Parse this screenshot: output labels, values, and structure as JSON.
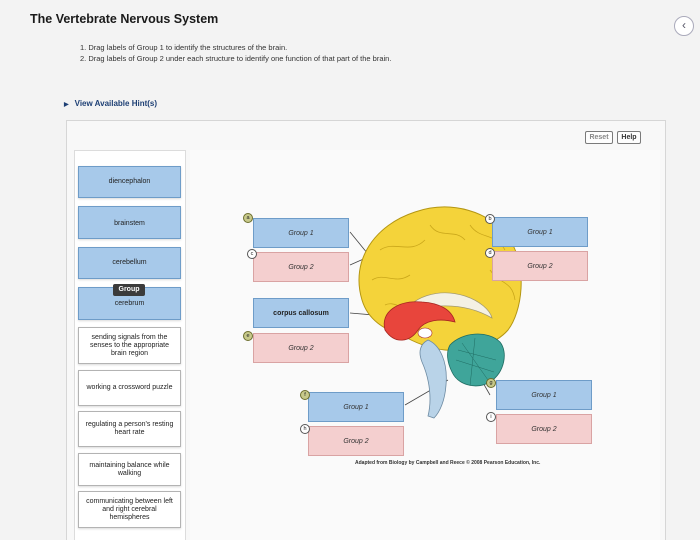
{
  "page": {
    "title": "The Vertebrate Nervous System",
    "instructions": [
      "1.  Drag labels of Group 1 to identify the structures of the brain.",
      "2.  Drag labels of Group 2 under each structure to identify one function of that part of the brain."
    ],
    "hints_link": "View Available Hint(s)"
  },
  "toolbar": {
    "reset_label": "Reset",
    "help_label": "Help"
  },
  "labels": {
    "diencephalon": "diencephalon",
    "brainstem": "brainstem",
    "cerebellum": "cerebellum",
    "cerebrum": "cerebrum",
    "drag_tag": "Group",
    "sensory": "sending signals from the senses to the appropriate brain region",
    "crossword": "working a crossword puzzle",
    "heart": "regulating a person's resting heart rate",
    "balance": "maintaining balance while walking",
    "hemispheres": "communicating between left and right cerebral hemispheres"
  },
  "targets": {
    "a_group1": "Group 1",
    "c_group2": "Group 2",
    "corpus": "corpus callosum",
    "e_group2": "Group 2",
    "b_group1": "Group 1",
    "d_group2": "Group 2",
    "f_group1": "Group 1",
    "h_group2": "Group 2",
    "g_group1": "Group 1",
    "i_group2": "Group 2"
  },
  "pins": {
    "a": "a",
    "b": "b",
    "c": "c",
    "d": "d",
    "e": "e",
    "f": "f",
    "g": "g",
    "h": "h",
    "i": "i"
  },
  "credit": "Adapted from Biology by Campbell and Reece © 2008 Pearson Education, Inc.",
  "colors": {
    "group1": "#a7c9ea",
    "group2": "#f4cfcf",
    "cerebrum": "#f4d33a",
    "diencephalon": "#e8453c",
    "cerebellum": "#3fa59a"
  },
  "icons": {
    "back": "chevron-left-icon",
    "hints": "triangle-right-icon"
  }
}
